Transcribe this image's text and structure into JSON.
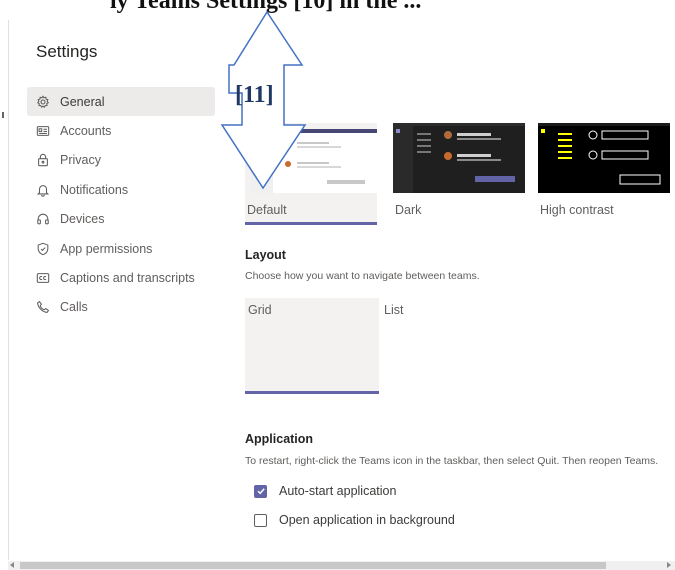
{
  "top_caption": "ly Teams Settings [10] in the ...",
  "settings": {
    "title": "Settings",
    "nav": [
      {
        "label": "General",
        "icon": "gear-icon",
        "active": true
      },
      {
        "label": "Accounts",
        "icon": "id-card-icon"
      },
      {
        "label": "Privacy",
        "icon": "lock-icon"
      },
      {
        "label": "Notifications",
        "icon": "bell-icon"
      },
      {
        "label": "Devices",
        "icon": "headset-icon"
      },
      {
        "label": "App permissions",
        "icon": "shield-icon"
      },
      {
        "label": "Captions and transcripts",
        "icon": "cc-icon"
      },
      {
        "label": "Calls",
        "icon": "phone-icon"
      }
    ]
  },
  "theme": {
    "options": [
      {
        "label": "Default",
        "selected": true
      },
      {
        "label": "Dark",
        "selected": false
      },
      {
        "label": "High contrast",
        "selected": false
      }
    ]
  },
  "layout": {
    "title": "Layout",
    "description": "Choose how you want to navigate between teams.",
    "options": [
      {
        "label": "Grid",
        "selected": true
      },
      {
        "label": "List",
        "selected": false
      }
    ]
  },
  "application": {
    "title": "Application",
    "description": "To restart, right-click the Teams icon in the taskbar, then select Quit. Then reopen Teams.",
    "options": [
      {
        "label": "Auto-start application",
        "checked": true
      },
      {
        "label": "Open application in background",
        "checked": false
      }
    ]
  },
  "callout": {
    "label": "[11]"
  },
  "colors": {
    "accent": "#6264a7",
    "selected_bg": "#edebe9",
    "callout_text": "#1f3864"
  }
}
